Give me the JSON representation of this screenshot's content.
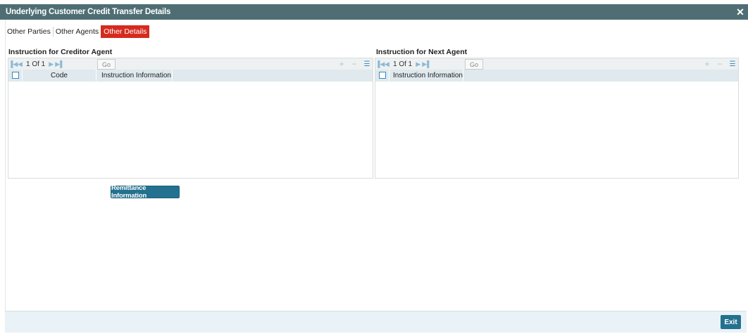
{
  "window": {
    "title": "Underlying Customer Credit Transfer Details",
    "close_glyph": "✕"
  },
  "tabs": [
    {
      "label": "Other Parties",
      "active": false
    },
    {
      "label": "Other Agents",
      "active": false
    },
    {
      "label": "Other Details",
      "active": true
    }
  ],
  "creditor_agent": {
    "title": "Instruction for Creditor Agent",
    "pagination": {
      "text": "1 Of 1",
      "go_label": "Go"
    },
    "columns": [
      "Code",
      "Instruction Information"
    ],
    "rows": []
  },
  "next_agent": {
    "title": "Instruction for Next Agent",
    "pagination": {
      "text": "1 Of 1",
      "go_label": "Go"
    },
    "columns": [
      "Instruction Information"
    ],
    "rows": []
  },
  "buttons": {
    "remittance": "Remittance Information",
    "exit": "Exit"
  },
  "icons": {
    "first": "first-page-icon",
    "prev": "previous-page-icon",
    "next": "next-page-icon",
    "last": "last-page-icon",
    "add": "add-row-icon",
    "delete": "delete-row-icon",
    "columns": "column-settings-icon"
  },
  "colors": {
    "titlebar": "#4e6e74",
    "active_tab": "#d52b1e",
    "button": "#24718f",
    "grid_header": "#dfe9ee"
  }
}
